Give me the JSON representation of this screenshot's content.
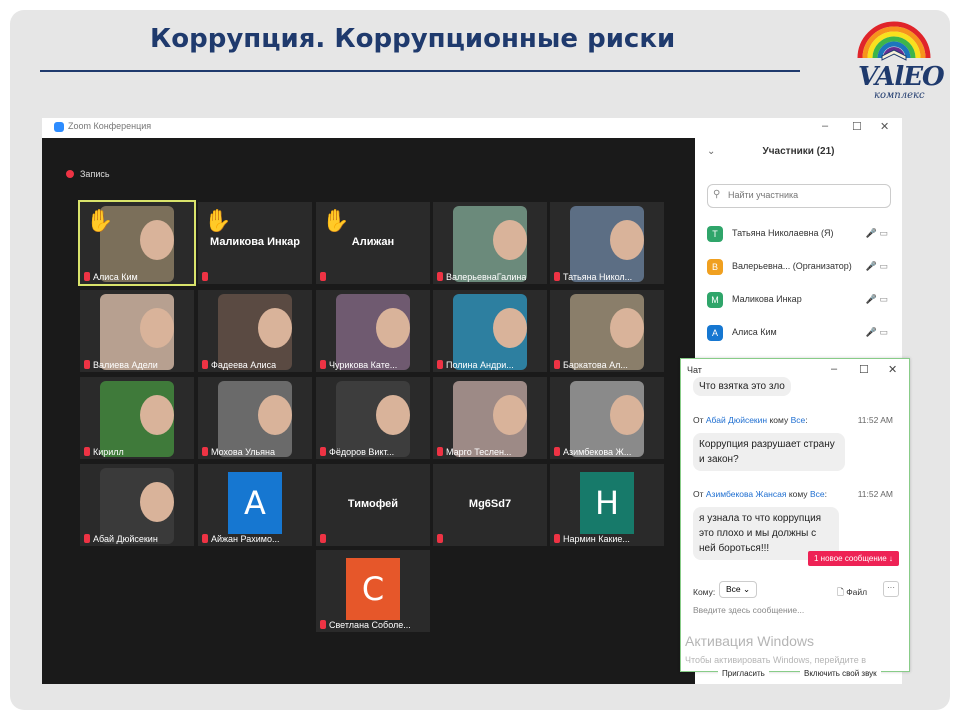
{
  "slide": {
    "title": "Коррупция. Коррупционные риски",
    "logo_text": "VAlEO",
    "logo_sub": "комплекс"
  },
  "zoom": {
    "window_title": "Zoom Конференция",
    "recording": "Запись",
    "tiles": [
      {
        "name": "Алиса Ким",
        "kind": "video",
        "hand": true,
        "color": "#7b6f5a"
      },
      {
        "name": "Маликова Инкар",
        "kind": "name",
        "hand": true
      },
      {
        "name": "Алижан",
        "kind": "name",
        "hand": true
      },
      {
        "name": "ВалерьевнаГалина",
        "kind": "video",
        "color": "#6b8a7b"
      },
      {
        "name": "Татьяна Никол...",
        "kind": "video",
        "color": "#5c6e84"
      },
      {
        "name": "Валиева Адели",
        "kind": "video",
        "color": "#b7a090"
      },
      {
        "name": "Фадеева Алиса",
        "kind": "video",
        "color": "#5a4a42"
      },
      {
        "name": "Чурикова Кате...",
        "kind": "video",
        "color": "#6f5a70"
      },
      {
        "name": "Полина Андри...",
        "kind": "video",
        "color": "#2d7fa0"
      },
      {
        "name": "Баркатова Ал...",
        "kind": "video",
        "color": "#8a7e6a"
      },
      {
        "name": "Кирилл",
        "kind": "video",
        "color": "#3f7a3a"
      },
      {
        "name": "Мохова Ульяна",
        "kind": "video",
        "color": "#6a6a6a"
      },
      {
        "name": "Фёдоров Викт...",
        "kind": "video",
        "color": "#3d3d3d"
      },
      {
        "name": "Марго Теслен...",
        "kind": "video",
        "color": "#9d8a86"
      },
      {
        "name": "Азимбекова Ж...",
        "kind": "video",
        "color": "#8a8a8a"
      },
      {
        "name": "Абай Дюйсекин",
        "kind": "video",
        "color": "#3a3a3a"
      },
      {
        "name": "Айжан Рахимо...",
        "kind": "avatar",
        "letter": "A",
        "color": "#1677d1"
      },
      {
        "name": "Тимофей",
        "kind": "name"
      },
      {
        "name": "Mg6Sd7",
        "kind": "name"
      },
      {
        "name": "Нармин Какие...",
        "kind": "avatar",
        "letter": "H",
        "color": "#177a6a"
      },
      {
        "name": "Светлана Соболе...",
        "kind": "avatar",
        "letter": "C",
        "color": "#e6572a"
      }
    ]
  },
  "participants": {
    "header": "Участники (21)",
    "search_placeholder": "Найти участника",
    "items": [
      {
        "initial": "Т",
        "name": "Татьяна Николаевна (Я)",
        "color": "#2fa56a"
      },
      {
        "initial": "В",
        "name": "Валерьевна... (Организатор)",
        "color": "#f0a020"
      },
      {
        "initial": "М",
        "name": "Маликова Инкар",
        "color": "#2fa56a"
      },
      {
        "initial": "А",
        "name": "Алиса Ким",
        "color": "#1677d1"
      }
    ]
  },
  "chat": {
    "title": "Чат",
    "partial_message": "Что взятка это зло",
    "messages": [
      {
        "from": "Абай Дюйсекин",
        "to": "Все",
        "time": "11:52 AM",
        "text": "Коррупция разрушает страну и закон?"
      },
      {
        "from": "Азимбекова Жансая",
        "to": "Все",
        "time": "11:52 AM",
        "text": "я узнала то что коррупция это плохо и мы должны с ней бороться!!!"
      }
    ],
    "from_prefix": "От",
    "to_prefix": "кому",
    "new_messages": "1 новое сообщение ↓",
    "to_label": "Кому:",
    "to_value": "Все",
    "file_label": "Файл",
    "input_placeholder": "Введите здесь сообщение...",
    "activation_title": "Активация Windows",
    "activation_text": "Чтобы активировать Windows, перейдите в",
    "bottom_left": "Пригласить",
    "bottom_right": "Включить свой звук"
  }
}
